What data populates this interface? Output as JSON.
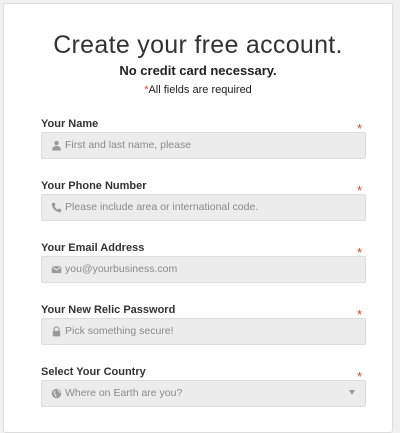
{
  "header": {
    "title": "Create your free account.",
    "subtitle": "No credit card necessary.",
    "required_note_star": "*",
    "required_note_text": "All fields are required"
  },
  "fields": [
    {
      "label": "Your Name",
      "placeholder": "First and last name, please",
      "icon": "person-icon",
      "required": "*"
    },
    {
      "label": "Your Phone Number",
      "placeholder": "Please include area or international code.",
      "icon": "phone-icon",
      "required": "*"
    },
    {
      "label": "Your Email Address",
      "placeholder": "you@yourbusiness.com",
      "icon": "email-icon",
      "required": "*"
    },
    {
      "label": "Your New Relic Password",
      "placeholder": "Pick something secure!",
      "icon": "lock-icon",
      "required": "*"
    },
    {
      "label": "Select Your Country",
      "placeholder": "Where on Earth are you?",
      "icon": "globe-icon",
      "required": "*"
    }
  ],
  "colors": {
    "required_star": "#e0442b",
    "input_bg": "#ececec",
    "placeholder": "#8a8a8a"
  }
}
